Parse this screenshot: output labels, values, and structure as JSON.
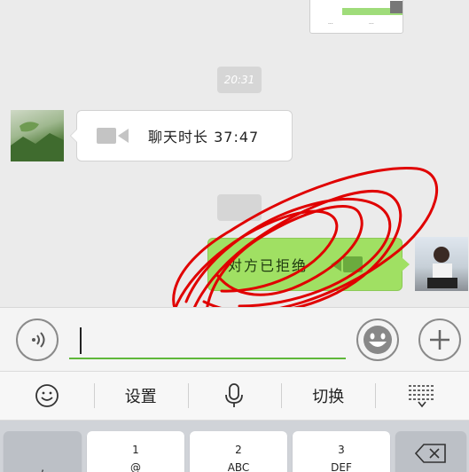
{
  "chat": {
    "timestamp_1": "20:31",
    "incoming_call": {
      "duration_text": "聊天时长 37:47",
      "icon": "video-call-icon"
    },
    "outgoing_call": {
      "status_text": "对方已拒绝",
      "icon": "video-call-icon"
    },
    "image_preview": {
      "text_1": "...",
      "text_2": "..."
    }
  },
  "input": {
    "placeholder": "",
    "value": ""
  },
  "ime_bar": {
    "emoji": "emoji-face-icon",
    "settings": "设置",
    "voice": "microphone-icon",
    "switch": "切换",
    "collapse": "keyboard-collapse-icon"
  },
  "keyboard": {
    "keys": [
      {
        "num": "",
        "sub": ","
      },
      {
        "num": "1",
        "sub": "@"
      },
      {
        "num": "2",
        "sub": "ABC"
      },
      {
        "num": "3",
        "sub": "DEF"
      }
    ]
  },
  "colors": {
    "outgoing_bubble": "#a0e063",
    "scribble": "#e00000",
    "input_underline": "#5fb83a"
  }
}
